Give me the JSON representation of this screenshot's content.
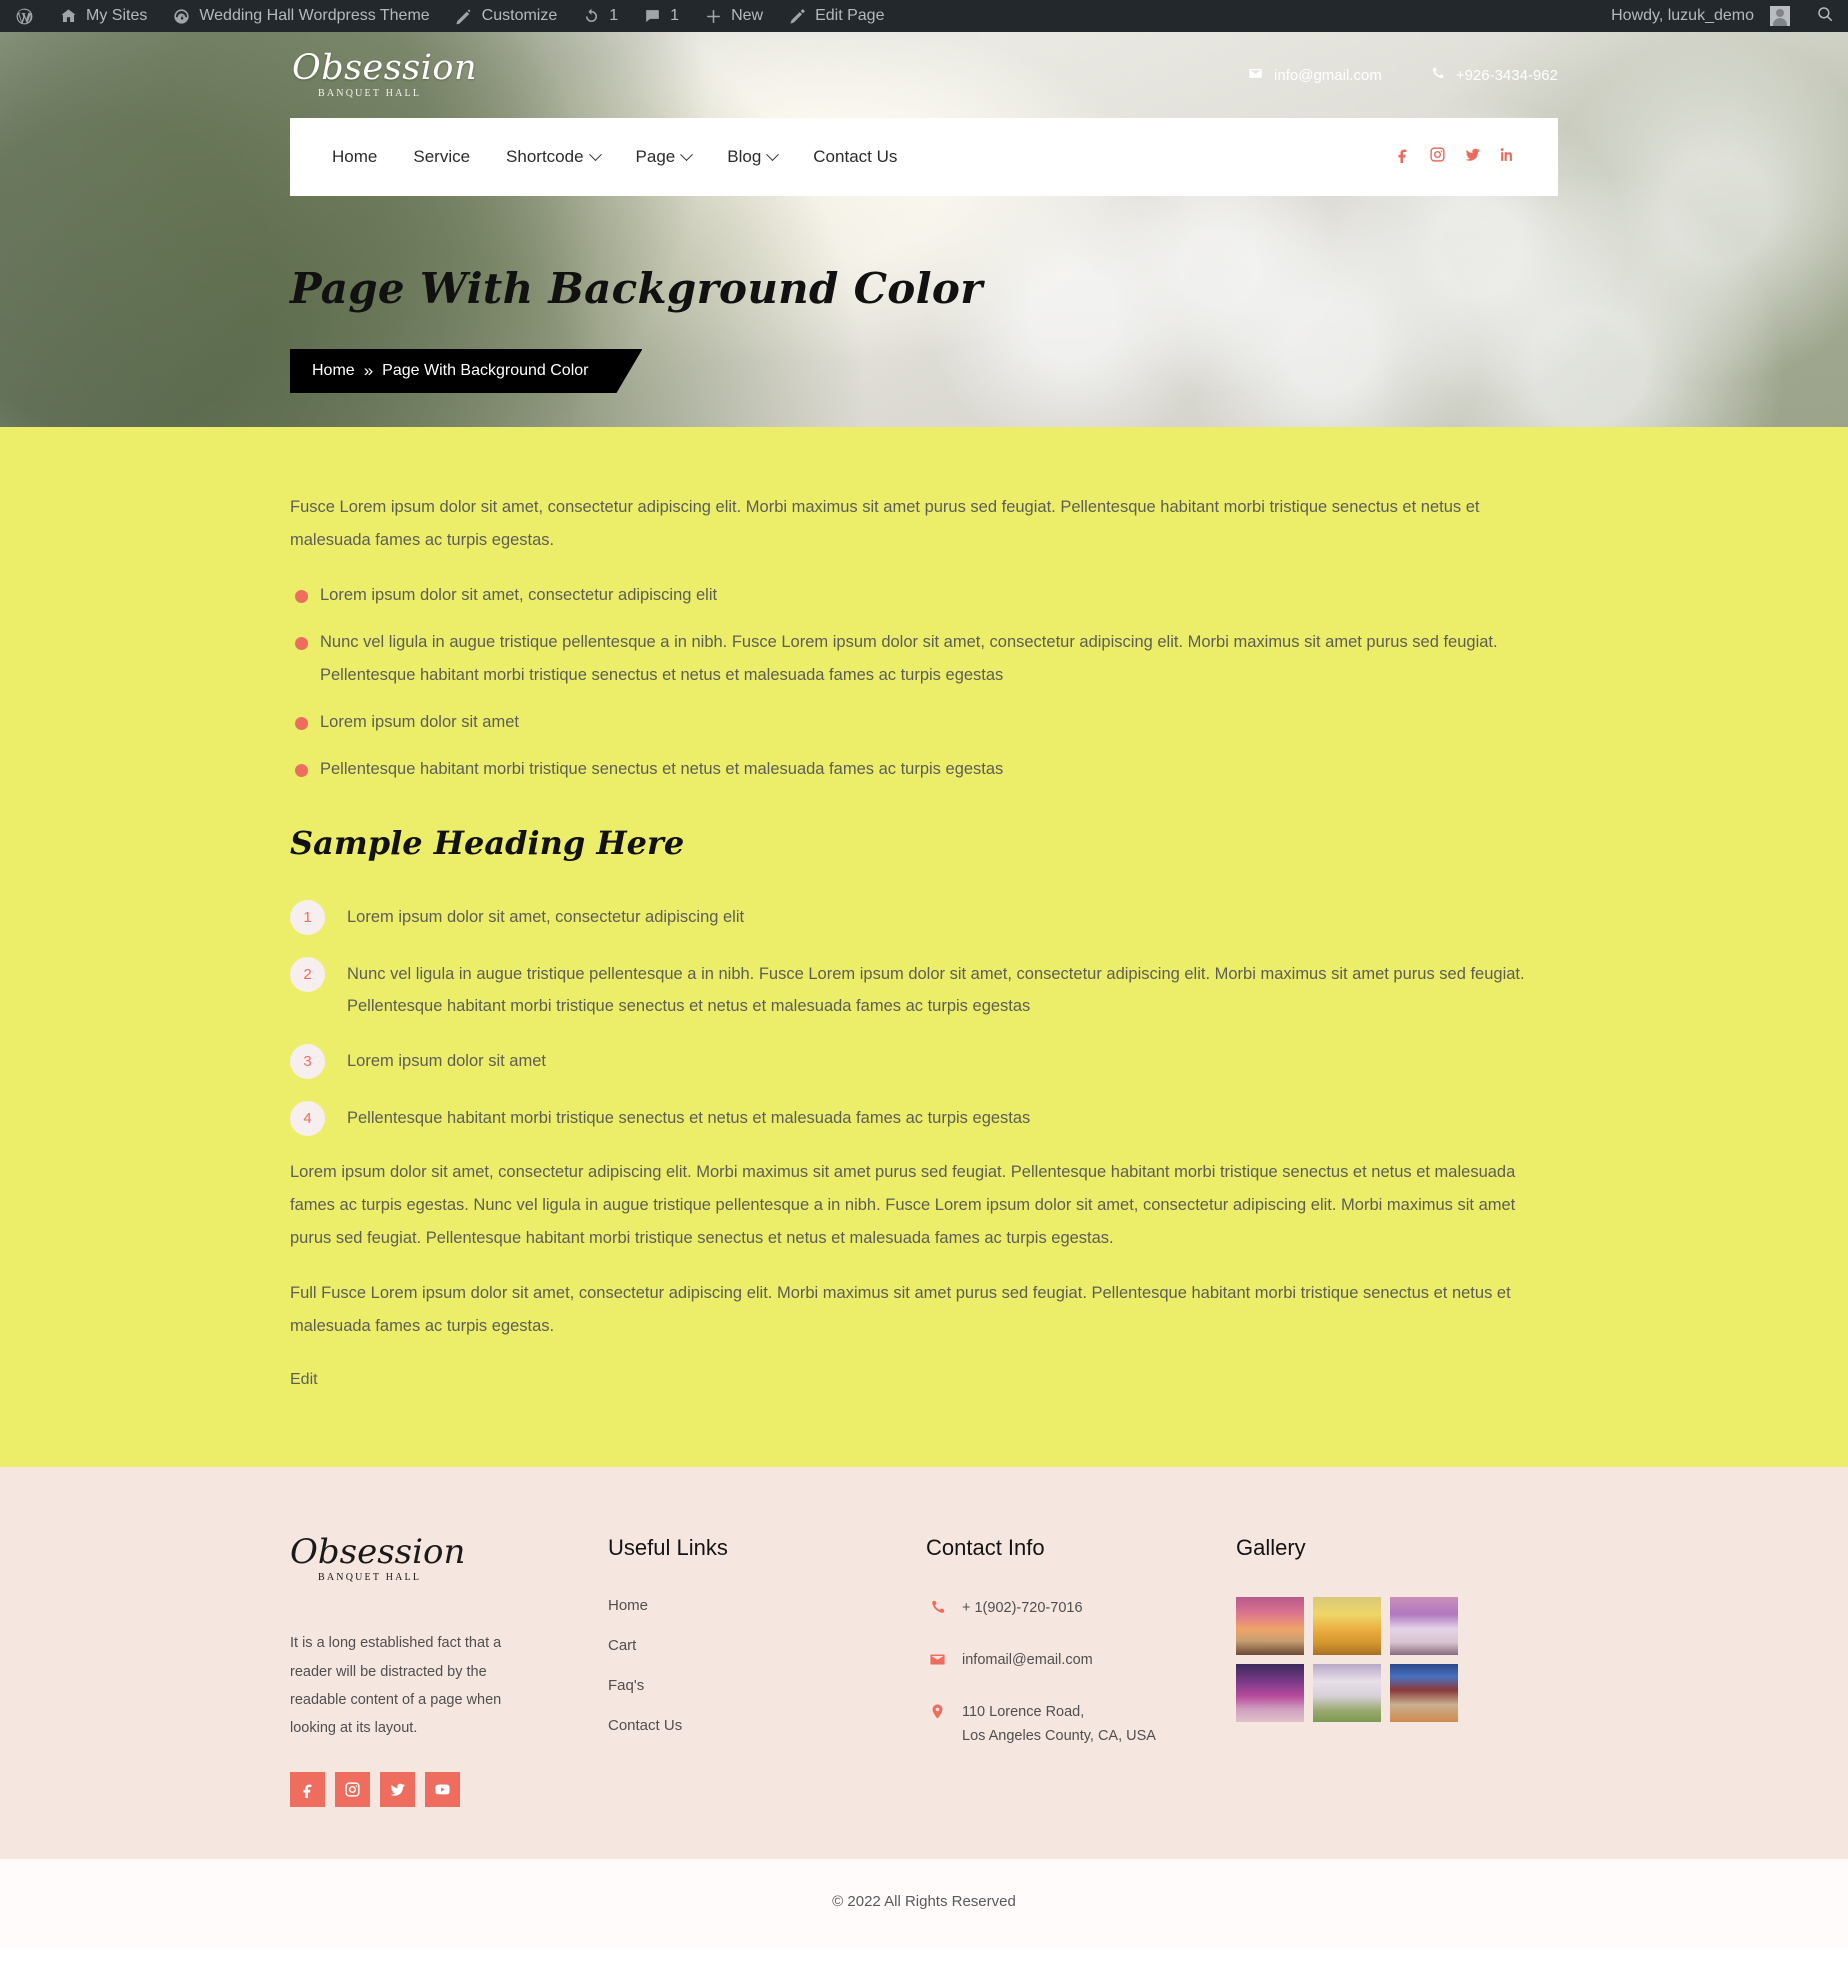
{
  "adminbar": {
    "items": [
      {
        "icon": "wordpress-icon",
        "label": ""
      },
      {
        "icon": "sites-icon",
        "label": "My Sites"
      },
      {
        "icon": "dashboard-icon",
        "label": "Wedding Hall Wordpress Theme"
      },
      {
        "icon": "customize-icon",
        "label": "Customize"
      },
      {
        "icon": "updates-icon",
        "label": "1"
      },
      {
        "icon": "comments-icon",
        "label": "1"
      },
      {
        "icon": "plus-icon",
        "label": "New"
      },
      {
        "icon": "pencil-icon",
        "label": "Edit Page"
      }
    ],
    "howdy": "Howdy, luzuk_demo",
    "search_icon": "search-icon"
  },
  "header": {
    "brand": {
      "script": "Obsession",
      "sub": "Banquet Hall"
    },
    "email": "info@gmail.com",
    "phone": "+926-3434-962",
    "nav": [
      {
        "label": "Home",
        "has_caret": false
      },
      {
        "label": "Service",
        "has_caret": false
      },
      {
        "label": "Shortcode",
        "has_caret": true
      },
      {
        "label": "Page",
        "has_caret": true
      },
      {
        "label": "Blog",
        "has_caret": true
      },
      {
        "label": "Contact Us",
        "has_caret": false
      }
    ],
    "social": [
      "facebook-icon",
      "instagram-icon",
      "twitter-icon",
      "linkedin-icon"
    ]
  },
  "hero": {
    "title": "Page With Background Color",
    "breadcrumb": {
      "home": "Home",
      "separator": "»",
      "current": "Page With Background Color"
    }
  },
  "main": {
    "intro": "Fusce Lorem ipsum dolor sit amet, consectetur adipiscing elit. Morbi maximus sit amet purus sed feugiat. Pellentesque habitant morbi tristique senectus et netus et malesuada fames ac turpis egestas.",
    "bullets": [
      "Lorem ipsum dolor sit amet, consectetur adipiscing elit",
      "Nunc vel ligula in augue tristique pellentesque a in nibh. Fusce Lorem ipsum dolor sit amet, consectetur adipiscing elit. Morbi maximus sit amet purus sed feugiat. Pellentesque habitant morbi tristique senectus et netus et malesuada fames ac turpis egestas",
      "Lorem ipsum dolor sit amet",
      "Pellentesque habitant morbi tristique senectus et netus et malesuada fames ac turpis egestas"
    ],
    "heading": "Sample Heading Here",
    "numbered": [
      {
        "n": "1",
        "text": "Lorem ipsum dolor sit amet, consectetur adipiscing elit"
      },
      {
        "n": "2",
        "text": "Nunc vel ligula in augue tristique pellentesque a in nibh. Fusce Lorem ipsum dolor sit amet, consectetur adipiscing elit. Morbi maximus sit amet purus sed feugiat. Pellentesque habitant morbi tristique senectus et netus et malesuada fames ac turpis egestas"
      },
      {
        "n": "3",
        "text": "Lorem ipsum dolor sit amet"
      },
      {
        "n": "4",
        "text": "Pellentesque habitant morbi tristique senectus et netus et malesuada fames ac turpis egestas"
      }
    ],
    "para2": "Lorem ipsum dolor sit amet, consectetur adipiscing elit. Morbi maximus sit amet purus sed feugiat. Pellentesque habitant morbi tristique senectus et netus et malesuada fames ac turpis egestas. Nunc vel ligula in augue tristique pellentesque a in nibh. Fusce Lorem ipsum dolor sit amet, consectetur adipiscing elit. Morbi maximus sit amet purus sed feugiat. Pellentesque habitant morbi tristique senectus et netus et malesuada fames ac turpis egestas.",
    "para3": "Full Fusce Lorem ipsum dolor sit amet, consectetur adipiscing elit. Morbi maximus sit amet purus sed feugiat. Pellentesque habitant morbi tristique senectus et netus et malesuada fames ac turpis egestas.",
    "edit": "Edit"
  },
  "footer": {
    "brand": {
      "script": "Obsession",
      "sub": "Banquet Hall"
    },
    "about": "It is a long established fact that a reader will be distracted by the readable content of a page when looking at its layout.",
    "social": [
      "facebook-icon",
      "instagram-icon",
      "twitter-icon",
      "youtube-icon"
    ],
    "links_heading": "Useful Links",
    "links": [
      "Home",
      "Cart",
      "Faq's",
      "Contact Us"
    ],
    "contact_heading": "Contact Info",
    "contact": [
      {
        "icon": "phone-icon",
        "text": "+ 1(902)-720-7016"
      },
      {
        "icon": "envelope-icon",
        "text": "infomail@email.com"
      },
      {
        "icon": "map-pin-icon",
        "text": "110 Lorence Road,\nLos Angeles County, CA, USA"
      }
    ],
    "gallery_heading": "Gallery",
    "gallery": [
      "gallery-thumb-1",
      "gallery-thumb-2",
      "gallery-thumb-3",
      "gallery-thumb-4",
      "gallery-thumb-5",
      "gallery-thumb-6"
    ],
    "copyright": "© 2022 All Rights Reserved"
  },
  "colors": {
    "accent": "#ef6d5e",
    "content_bg": "#ecee6a",
    "footer_bg": "#f6e6e0",
    "adminbar_bg": "#23282d"
  }
}
